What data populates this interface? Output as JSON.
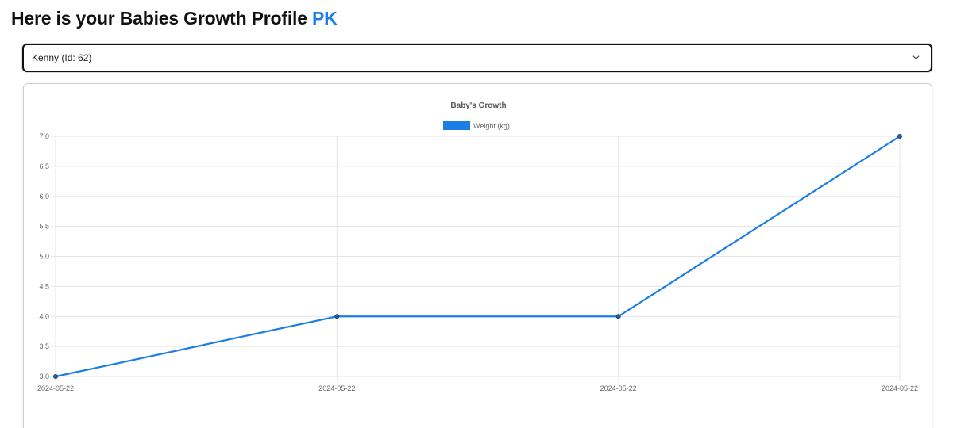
{
  "header": {
    "title": "Here is your Babies Growth Profile",
    "accent": "PK",
    "accent_color": "#1a7ee6"
  },
  "baby_select": {
    "selected": "Kenny (Id: 62)",
    "icon": "chevron-down-icon"
  },
  "chart_data": {
    "type": "line",
    "title": "Baby's Growth",
    "categories": [
      "2024-05-22",
      "2024-05-22",
      "2024-05-22",
      "2024-05-22"
    ],
    "series": [
      {
        "name": "Weight (kg)",
        "values": [
          3.0,
          4.0,
          4.0,
          7.0
        ],
        "color": "#1a7ee6"
      }
    ],
    "ylim": [
      3.0,
      7.0
    ],
    "yticks": [
      "3.0",
      "3.5",
      "4.0",
      "4.5",
      "5.0",
      "5.5",
      "6.0",
      "6.5",
      "7.0"
    ],
    "grid": true,
    "legend": "top-center"
  }
}
